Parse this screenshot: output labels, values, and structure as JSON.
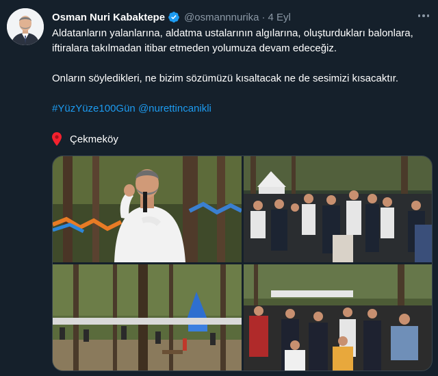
{
  "tweet": {
    "author_name": "Osman Nuri Kabaktepe",
    "handle": "@osmannnurika",
    "separator": "·",
    "date": "4 Eyl",
    "paragraph1": "Aldatanların yalanlarına, aldatma ustalarının algılarına, oluşturdukları balonlara, iftiralara takılmadan itibar etmeden yolumuza devam edeceğiz.",
    "paragraph2": "Onların söyledikleri, ne bizim sözümüzü kısaltacak ne de sesimizi kısacaktır.",
    "hashtag": "#YüzYüze100Gün",
    "mention": "@nurettincanikli",
    "location_icon": "map-pin-icon",
    "location": "Çekmeköy"
  },
  "colors": {
    "background": "#15202b",
    "text": "#ffffff",
    "muted": "#8b98a5",
    "link": "#1d9bf0",
    "verified_badge": "#1d9bf0",
    "border": "#38444d",
    "pin": "#f4212e"
  },
  "media": {
    "photos": [
      {
        "subject": "speaker with microphone in forest"
      },
      {
        "subject": "crowd gathered under trees"
      },
      {
        "subject": "picnic area with tents in forest"
      },
      {
        "subject": "crowd of people in forest"
      }
    ]
  }
}
